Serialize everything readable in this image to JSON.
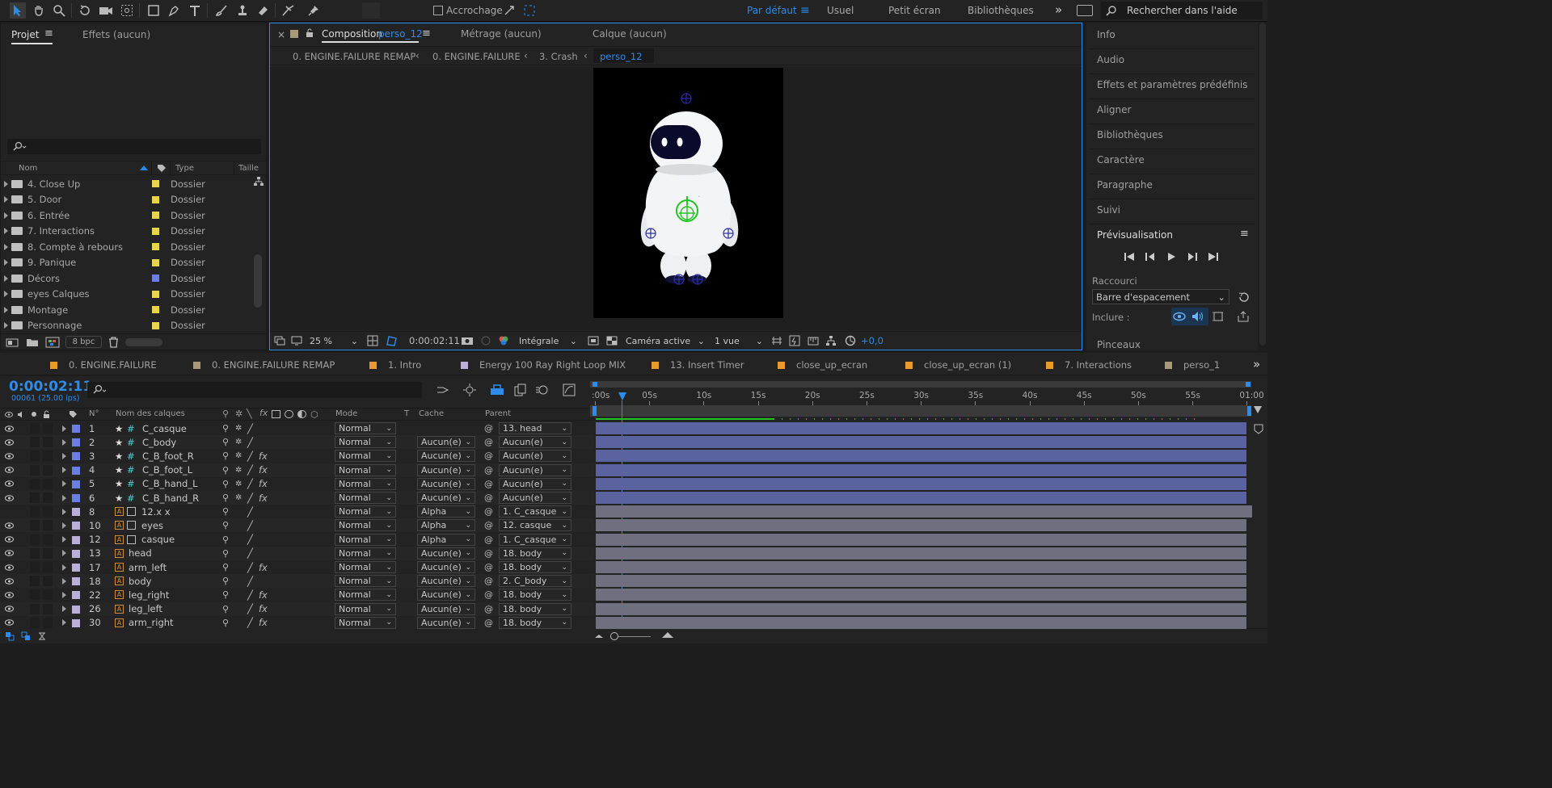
{
  "toolbar": {
    "snapping_label": "Accrochage",
    "workspaces": [
      "Par défaut",
      "Usuel",
      "Petit écran",
      "Bibliothèques"
    ],
    "search_placeholder": "Rechercher dans l'aide"
  },
  "project_panel": {
    "tab_project": "Projet",
    "tab_effects": "Effets",
    "tab_effects_value": "(aucun)",
    "columns": {
      "name": "Nom",
      "type": "Type",
      "size": "Taille"
    },
    "items": [
      {
        "name": "4. Close Up",
        "type": "Dossier",
        "color": "#e8d44d"
      },
      {
        "name": "5. Door",
        "type": "Dossier",
        "color": "#e8d44d"
      },
      {
        "name": "6. Entrée",
        "type": "Dossier",
        "color": "#e8d44d"
      },
      {
        "name": "7. Interactions",
        "type": "Dossier",
        "color": "#e8d44d"
      },
      {
        "name": "8. Compte à rebours",
        "type": "Dossier",
        "color": "#e8d44d"
      },
      {
        "name": "9. Panique",
        "type": "Dossier",
        "color": "#e8d44d"
      },
      {
        "name": "Décors",
        "type": "Dossier",
        "color": "#6b7fe0"
      },
      {
        "name": "eyes Calques",
        "type": "Dossier",
        "color": "#e8d44d"
      },
      {
        "name": "Montage",
        "type": "Dossier",
        "color": "#e8d44d"
      },
      {
        "name": "Personnage",
        "type": "Dossier",
        "color": "#e8d44d"
      }
    ],
    "bpc": "8 bpc"
  },
  "comp_panel": {
    "tab_label": "Composition",
    "tab_name": "perso_12",
    "footage_label": "Métrage",
    "footage_value": "(aucun)",
    "layer_label": "Calque",
    "layer_value": "(aucun)",
    "breadcrumbs": [
      "0. ENGINE.FAILURE REMAP",
      "0. ENGINE.FAILURE",
      "3. Crash",
      "perso_12"
    ],
    "zoom": "25 %",
    "timecode": "0:00:02:11",
    "resolution": "Intégrale",
    "camera": "Caméra active",
    "views": "1 vue",
    "exposure": "+0,0"
  },
  "right_panel": {
    "items": [
      "Info",
      "Audio",
      "Effets et paramètres prédéfinis",
      "Aligner",
      "Bibliothèques",
      "Caractère",
      "Paragraphe",
      "Suivi"
    ],
    "preview_title": "Prévisualisation",
    "shortcut_label": "Raccourci",
    "shortcut_value": "Barre d'espacement",
    "include_label": "Inclure :",
    "brushes": "Pinceaux"
  },
  "comp_tabs": [
    {
      "name": "0. ENGINE.FAILURE",
      "color": "#e89a2c"
    },
    {
      "name": "0. ENGINE.FAILURE REMAP",
      "color": "#a89a78"
    },
    {
      "name": "1. Intro",
      "color": "#e89a2c"
    },
    {
      "name": "Energy 100 Ray Right Loop MIX",
      "color": "#b8b0d8"
    },
    {
      "name": "13. Insert Timer",
      "color": "#e89a2c"
    },
    {
      "name": "close_up_ecran",
      "color": "#e89a2c"
    },
    {
      "name": "close_up_ecran (1)",
      "color": "#e89a2c"
    },
    {
      "name": "7. Interactions",
      "color": "#e89a2c"
    },
    {
      "name": "perso_1",
      "color": "#a89a78"
    }
  ],
  "timeline": {
    "timecode": "0:00:02:11",
    "frames": "00061 (25.00 ips)",
    "col_num": "N°",
    "col_name": "Nom des calques",
    "col_mode": "Mode",
    "col_t": "T",
    "col_matte": "Cache",
    "col_parent": "Parent",
    "ruler": [
      ":00s",
      "05s",
      "10s",
      "15s",
      "20s",
      "25s",
      "30s",
      "35s",
      "40s",
      "45s",
      "50s",
      "55s",
      "01:00"
    ],
    "layers": [
      {
        "num": "1",
        "name": "C_casque",
        "kind": "null",
        "mode": "Normal",
        "matte": "",
        "parent": "13. head",
        "fx": false,
        "color": "#6b7fe0",
        "eye": true
      },
      {
        "num": "2",
        "name": "C_body",
        "kind": "null",
        "mode": "Normal",
        "matte": "Aucun(e)",
        "parent": "Aucun(e)",
        "fx": false,
        "color": "#6b7fe0",
        "eye": true
      },
      {
        "num": "3",
        "name": "C_B_foot_R",
        "kind": "null",
        "mode": "Normal",
        "matte": "Aucun(e)",
        "parent": "Aucun(e)",
        "fx": true,
        "color": "#6b7fe0",
        "eye": true
      },
      {
        "num": "4",
        "name": "C_B_foot_L",
        "kind": "null",
        "mode": "Normal",
        "matte": "Aucun(e)",
        "parent": "Aucun(e)",
        "fx": true,
        "color": "#6b7fe0",
        "eye": true
      },
      {
        "num": "5",
        "name": "C_B_hand_L",
        "kind": "null",
        "mode": "Normal",
        "matte": "Aucun(e)",
        "parent": "Aucun(e)",
        "fx": true,
        "color": "#6b7fe0",
        "eye": true
      },
      {
        "num": "6",
        "name": "C_B_hand_R",
        "kind": "null",
        "mode": "Normal",
        "matte": "Aucun(e)",
        "parent": "Aucun(e)",
        "fx": true,
        "color": "#6b7fe0",
        "eye": true
      },
      {
        "num": "8",
        "name": "12.x x",
        "kind": "comp",
        "mode": "Normal",
        "matte": "Alpha",
        "parent": "1. C_casque",
        "fx": false,
        "color": "#b8b0d8",
        "eye": false
      },
      {
        "num": "10",
        "name": "eyes",
        "kind": "comp",
        "mode": "Normal",
        "matte": "Alpha",
        "parent": "12. casque",
        "fx": false,
        "color": "#b8b0d8",
        "eye": true
      },
      {
        "num": "12",
        "name": "casque",
        "kind": "comp",
        "mode": "Normal",
        "matte": "Alpha",
        "parent": "1. C_casque",
        "fx": false,
        "color": "#b8b0d8",
        "eye": true
      },
      {
        "num": "13",
        "name": "head",
        "kind": "ai",
        "mode": "Normal",
        "matte": "Aucun(e)",
        "parent": "18. body",
        "fx": false,
        "color": "#b8b0d8",
        "eye": true
      },
      {
        "num": "17",
        "name": "arm_left",
        "kind": "ai",
        "mode": "Normal",
        "matte": "Aucun(e)",
        "parent": "18. body",
        "fx": true,
        "color": "#b8b0d8",
        "eye": true
      },
      {
        "num": "18",
        "name": "body",
        "kind": "ai",
        "mode": "Normal",
        "matte": "Aucun(e)",
        "parent": "2. C_body",
        "fx": false,
        "color": "#b8b0d8",
        "eye": true
      },
      {
        "num": "22",
        "name": "leg_right",
        "kind": "ai",
        "mode": "Normal",
        "matte": "Aucun(e)",
        "parent": "18. body",
        "fx": true,
        "color": "#b8b0d8",
        "eye": true
      },
      {
        "num": "26",
        "name": "leg_left",
        "kind": "ai",
        "mode": "Normal",
        "matte": "Aucun(e)",
        "parent": "18. body",
        "fx": true,
        "color": "#b8b0d8",
        "eye": true
      },
      {
        "num": "30",
        "name": "arm_right",
        "kind": "ai",
        "mode": "Normal",
        "matte": "Aucun(e)",
        "parent": "18. body",
        "fx": true,
        "color": "#b8b0d8",
        "eye": true
      }
    ]
  },
  "colors": {
    "accent": "#2d8ceb",
    "null_bar": "#5a62a0",
    "layer_bar": "#6f6f80"
  }
}
